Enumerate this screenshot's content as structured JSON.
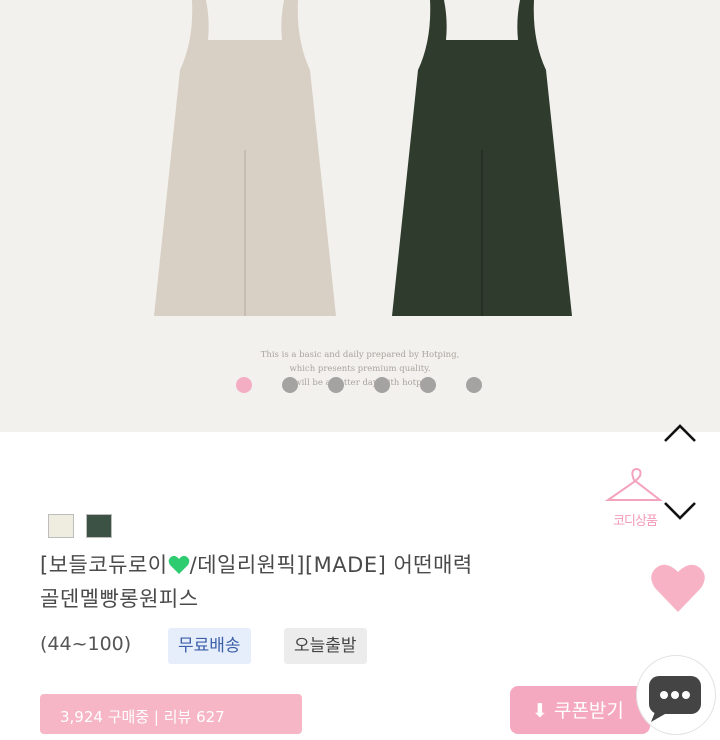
{
  "hero": {
    "caption_lines": [
      "This is a basic and daily prepared by Hotping,",
      "which presents premium quality.",
      "It will be a better day with hotping"
    ],
    "slides_total": 6,
    "active_slide": 1
  },
  "product": {
    "color_options": [
      {
        "name": "ivory-swatch",
        "color": "#efece0"
      },
      {
        "name": "khaki-swatch",
        "color": "#3b5244"
      }
    ],
    "title_part1": "[보들코듀로이",
    "title_part2": "/데일리원픽][MADE] 어떤매력",
    "title_line2": "골덴멜빵롱원피스",
    "size_range": "(44~100)",
    "badges": {
      "free_shipping": "무료배송",
      "ships_today": "오늘출발"
    },
    "stats": "3,924 구매중  |  리뷰 627"
  },
  "side": {
    "codi_label": "코디상품",
    "coupon_label": "⬇ 쿠폰받기"
  },
  "colors": {
    "accent_pink": "#f5a9c0",
    "heart_green": "#2ecc71"
  }
}
